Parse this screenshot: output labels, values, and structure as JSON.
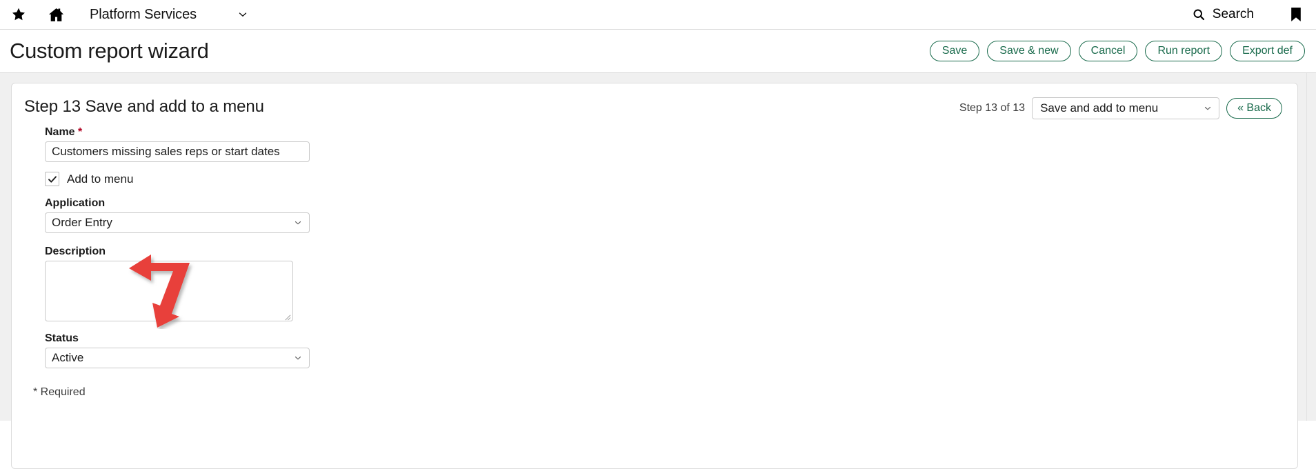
{
  "topbar": {
    "favorite_icon": "star-icon",
    "home_icon": "home-icon",
    "app_name": "Platform Services",
    "app_menu_icon": "chevron-down-icon",
    "search_icon": "search-icon",
    "search_label": "Search",
    "bookmark_icon": "bookmark-icon"
  },
  "header": {
    "title": "Custom report wizard",
    "actions": [
      {
        "label": "Save",
        "name": "save-button"
      },
      {
        "label": "Save & new",
        "name": "save-and-new-button"
      },
      {
        "label": "Cancel",
        "name": "cancel-button"
      },
      {
        "label": "Run report",
        "name": "run-report-button"
      },
      {
        "label": "Export def",
        "name": "export-def-button"
      }
    ]
  },
  "wizard": {
    "step_heading": "Step 13 Save and add to a menu",
    "step_count": "Step 13 of 13",
    "step_select_value": "Save and add to menu",
    "step_select_chevron": "chevron-down-icon",
    "back_button": "« Back"
  },
  "form": {
    "name": {
      "label": "Name",
      "required_marker": "*",
      "value": "Customers missing sales reps or start dates",
      "placeholder": ""
    },
    "add_to_menu": {
      "label": "Add to menu",
      "checked": true,
      "check_icon": "checkmark-icon"
    },
    "application": {
      "label": "Application",
      "value": "Order Entry",
      "chevron": "chevron-down-icon"
    },
    "description": {
      "label": "Description",
      "value": "",
      "placeholder": "",
      "resize_handle": "resize-grip-icon"
    },
    "status": {
      "label": "Status",
      "value": "Active",
      "chevron": "chevron-down-icon"
    },
    "required_note": "* Required"
  },
  "annotation": {
    "arrow_icon": "red-double-arrow-annotation",
    "color": "#e8413a"
  },
  "colors": {
    "accent_green": "#17694a",
    "required_red": "#b00020",
    "page_bg": "#f0f0f0",
    "card_bg": "#ffffff",
    "border": "#c9c9c9",
    "annotation_red": "#e8413a"
  }
}
